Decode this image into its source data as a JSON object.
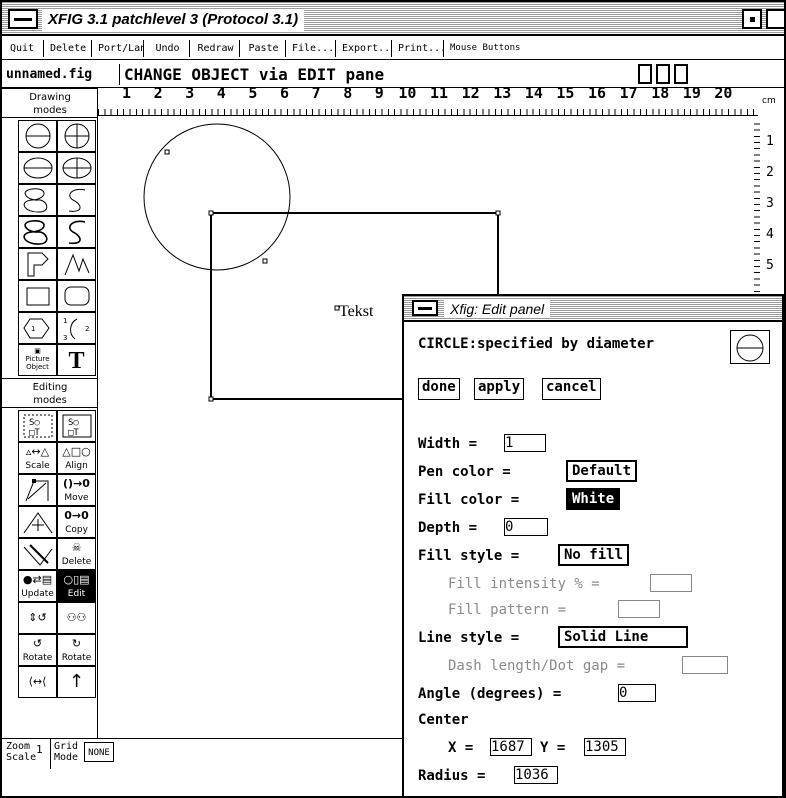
{
  "window": {
    "title": "XFIG 3.1 patchlevel 3 (Protocol 3.1)"
  },
  "commands": [
    "Quit",
    "Delete All",
    "Port/Land",
    "Undo",
    "Redraw",
    "Paste",
    "File...",
    "Export...",
    "Print...",
    "Mouse Buttons"
  ],
  "message": {
    "filename": "unnamed.fig",
    "text": "CHANGE OBJECT via EDIT pane"
  },
  "modes": {
    "drawing_header": [
      "Drawing",
      "modes"
    ],
    "editing_header": [
      "Editing",
      "modes"
    ],
    "labels": {
      "picture": "Picture Object",
      "text_tool": "T",
      "scale": "Scale",
      "align": "Align",
      "move": "Move",
      "copy": "Copy",
      "delete": "Delete",
      "update": "Update",
      "edit": "Edit",
      "rotate": "Rotate",
      "poly_a": "1",
      "poly_b": "2",
      "poly_c": "3"
    }
  },
  "ruler": {
    "top": [
      "1",
      "2",
      "3",
      "4",
      "5",
      "6",
      "7",
      "8",
      "9",
      "10",
      "11",
      "12",
      "13",
      "14",
      "15",
      "16",
      "17",
      "18",
      "19",
      "20"
    ],
    "unit": "cm",
    "side": [
      "1",
      "2",
      "3",
      "4",
      "5"
    ]
  },
  "canvas": {
    "text_label": "Tekst"
  },
  "bottom": {
    "zoom_label": "Zoom Scale",
    "zoom_value": "1",
    "grid_label": "Grid Mode",
    "grid_value": "NONE"
  },
  "edit_panel": {
    "title": "Xfig: Edit panel",
    "heading": "CIRCLE:specified by diameter",
    "buttons": {
      "done": "done",
      "apply": "apply",
      "cancel": "cancel"
    },
    "width": {
      "label": "Width =",
      "value": "1"
    },
    "pen_color": {
      "label": "Pen color  =",
      "value": "Default"
    },
    "fill_color": {
      "label": "Fill color =",
      "value": "White"
    },
    "depth": {
      "label": "Depth =",
      "value": "0"
    },
    "fill_style": {
      "label": "Fill style =",
      "value": "No fill"
    },
    "fill_intensity": {
      "label": "Fill intensity % =",
      "value": ""
    },
    "fill_pattern": {
      "label": "Fill pattern =",
      "value": ""
    },
    "line_style": {
      "label": "Line style =",
      "value": "Solid Line"
    },
    "dash_length": {
      "label": "Dash length/Dot gap =",
      "value": ""
    },
    "angle": {
      "label": "Angle (degrees) =",
      "value": "0"
    },
    "center": {
      "label": "Center",
      "x_label": "X =",
      "x": "1687",
      "y_label": "Y =",
      "y": "1305"
    },
    "radius": {
      "label": "Radius =",
      "value": "1036"
    }
  }
}
